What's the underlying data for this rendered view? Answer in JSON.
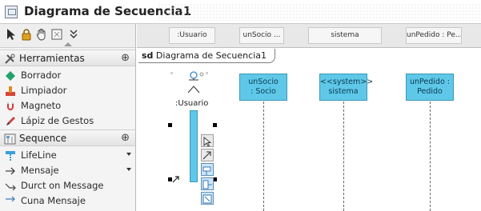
{
  "window": {
    "title": "Diagrama de Secuencia1"
  },
  "palette": {
    "tools": [
      {
        "name": "pointer-tool",
        "icon": "pointer-icon"
      },
      {
        "name": "lock-tool",
        "icon": "lock-icon"
      },
      {
        "name": "hand-tool",
        "icon": "hand-icon"
      },
      {
        "name": "note-tool",
        "icon": "note-icon"
      },
      {
        "name": "collapse-tool",
        "icon": "double-chevron-down-icon"
      }
    ],
    "sections": [
      {
        "label": "Herramientas",
        "items": [
          {
            "label": "Borrador",
            "icon": "eraser-icon"
          },
          {
            "label": "Limpiador",
            "icon": "cleaner-icon"
          },
          {
            "label": "Magneto",
            "icon": "magnet-icon"
          },
          {
            "label": "Lápiz de Gestos",
            "icon": "pencil-icon"
          }
        ]
      },
      {
        "label": "Sequence",
        "items": [
          {
            "label": "LifeLine",
            "icon": "lifeline-icon"
          },
          {
            "label": "Mensaje",
            "icon": "arrow-icon"
          },
          {
            "label": "Durct on Message",
            "icon": "duration-message-icon"
          },
          {
            "label": "Cuna Mensaje",
            "icon": "message-icon"
          }
        ]
      }
    ]
  },
  "header_strip": {
    "cells": [
      ":Usuario",
      "unSocio ...",
      "sistema",
      "unPedido : Pe..."
    ]
  },
  "diagram": {
    "tab_prefix": "sd",
    "tab_name": "Diagrama de Secuencia1",
    "actor_label": ":Usuario",
    "lifelines": [
      {
        "line1": "unSocio",
        "line2": ": Socio"
      },
      {
        "line1": "<<system>>",
        "line2": "sistema"
      },
      {
        "line1": "unPedido :",
        "line2": "Pedido"
      }
    ]
  },
  "colors": {
    "lifeline_fill": "#5fc8e8",
    "lifeline_border": "#3d97b4"
  }
}
